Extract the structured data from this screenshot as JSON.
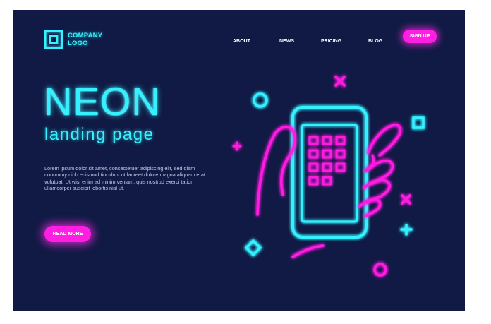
{
  "logo": {
    "line1": "COMPANY",
    "line2": "LOGO",
    "icon": "logo-square-icon"
  },
  "nav": {
    "items": [
      {
        "label": "ABOUT"
      },
      {
        "label": "NEWS"
      },
      {
        "label": "PRICING"
      },
      {
        "label": "BLOG"
      }
    ],
    "signup_label": "SIGN UP"
  },
  "hero": {
    "title": "NEON",
    "subtitle": "landing page",
    "body": "Lorem ipsum dolor sit amet, consectetuer adipiscing elit, sed diam nonummy nibh euismod tincidunt ut laoreet dolore magna aliquam erat volutpat. Ut wisi enim ad minim veniam, quis nostrud exerci tation ullamcorper suscipit lobortis nisl ut.",
    "cta_label": "READ MORE"
  },
  "colors": {
    "background": "#101a44",
    "neon_cyan": "#35f0ff",
    "neon_pink": "#ff1fe2",
    "text_light": "#c3c9e8"
  },
  "illustration": {
    "icons": [
      "hand-holding-phone-icon",
      "circle-icon",
      "x-icon",
      "plus-icon",
      "square-icon",
      "diamond-icon"
    ]
  }
}
